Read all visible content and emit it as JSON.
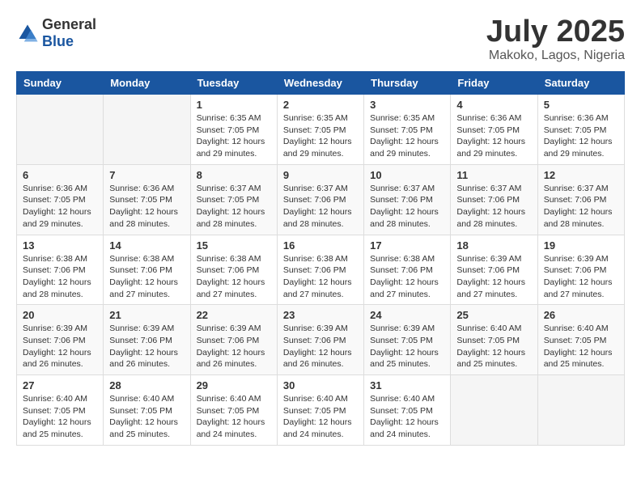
{
  "logo": {
    "general": "General",
    "blue": "Blue"
  },
  "header": {
    "month": "July 2025",
    "location": "Makoko, Lagos, Nigeria"
  },
  "weekdays": [
    "Sunday",
    "Monday",
    "Tuesday",
    "Wednesday",
    "Thursday",
    "Friday",
    "Saturday"
  ],
  "weeks": [
    [
      {
        "day": "",
        "info": ""
      },
      {
        "day": "",
        "info": ""
      },
      {
        "day": "1",
        "info": "Sunrise: 6:35 AM\nSunset: 7:05 PM\nDaylight: 12 hours\nand 29 minutes."
      },
      {
        "day": "2",
        "info": "Sunrise: 6:35 AM\nSunset: 7:05 PM\nDaylight: 12 hours\nand 29 minutes."
      },
      {
        "day": "3",
        "info": "Sunrise: 6:35 AM\nSunset: 7:05 PM\nDaylight: 12 hours\nand 29 minutes."
      },
      {
        "day": "4",
        "info": "Sunrise: 6:36 AM\nSunset: 7:05 PM\nDaylight: 12 hours\nand 29 minutes."
      },
      {
        "day": "5",
        "info": "Sunrise: 6:36 AM\nSunset: 7:05 PM\nDaylight: 12 hours\nand 29 minutes."
      }
    ],
    [
      {
        "day": "6",
        "info": "Sunrise: 6:36 AM\nSunset: 7:05 PM\nDaylight: 12 hours\nand 29 minutes."
      },
      {
        "day": "7",
        "info": "Sunrise: 6:36 AM\nSunset: 7:05 PM\nDaylight: 12 hours\nand 28 minutes."
      },
      {
        "day": "8",
        "info": "Sunrise: 6:37 AM\nSunset: 7:05 PM\nDaylight: 12 hours\nand 28 minutes."
      },
      {
        "day": "9",
        "info": "Sunrise: 6:37 AM\nSunset: 7:06 PM\nDaylight: 12 hours\nand 28 minutes."
      },
      {
        "day": "10",
        "info": "Sunrise: 6:37 AM\nSunset: 7:06 PM\nDaylight: 12 hours\nand 28 minutes."
      },
      {
        "day": "11",
        "info": "Sunrise: 6:37 AM\nSunset: 7:06 PM\nDaylight: 12 hours\nand 28 minutes."
      },
      {
        "day": "12",
        "info": "Sunrise: 6:37 AM\nSunset: 7:06 PM\nDaylight: 12 hours\nand 28 minutes."
      }
    ],
    [
      {
        "day": "13",
        "info": "Sunrise: 6:38 AM\nSunset: 7:06 PM\nDaylight: 12 hours\nand 28 minutes."
      },
      {
        "day": "14",
        "info": "Sunrise: 6:38 AM\nSunset: 7:06 PM\nDaylight: 12 hours\nand 27 minutes."
      },
      {
        "day": "15",
        "info": "Sunrise: 6:38 AM\nSunset: 7:06 PM\nDaylight: 12 hours\nand 27 minutes."
      },
      {
        "day": "16",
        "info": "Sunrise: 6:38 AM\nSunset: 7:06 PM\nDaylight: 12 hours\nand 27 minutes."
      },
      {
        "day": "17",
        "info": "Sunrise: 6:38 AM\nSunset: 7:06 PM\nDaylight: 12 hours\nand 27 minutes."
      },
      {
        "day": "18",
        "info": "Sunrise: 6:39 AM\nSunset: 7:06 PM\nDaylight: 12 hours\nand 27 minutes."
      },
      {
        "day": "19",
        "info": "Sunrise: 6:39 AM\nSunset: 7:06 PM\nDaylight: 12 hours\nand 27 minutes."
      }
    ],
    [
      {
        "day": "20",
        "info": "Sunrise: 6:39 AM\nSunset: 7:06 PM\nDaylight: 12 hours\nand 26 minutes."
      },
      {
        "day": "21",
        "info": "Sunrise: 6:39 AM\nSunset: 7:06 PM\nDaylight: 12 hours\nand 26 minutes."
      },
      {
        "day": "22",
        "info": "Sunrise: 6:39 AM\nSunset: 7:06 PM\nDaylight: 12 hours\nand 26 minutes."
      },
      {
        "day": "23",
        "info": "Sunrise: 6:39 AM\nSunset: 7:06 PM\nDaylight: 12 hours\nand 26 minutes."
      },
      {
        "day": "24",
        "info": "Sunrise: 6:39 AM\nSunset: 7:05 PM\nDaylight: 12 hours\nand 25 minutes."
      },
      {
        "day": "25",
        "info": "Sunrise: 6:40 AM\nSunset: 7:05 PM\nDaylight: 12 hours\nand 25 minutes."
      },
      {
        "day": "26",
        "info": "Sunrise: 6:40 AM\nSunset: 7:05 PM\nDaylight: 12 hours\nand 25 minutes."
      }
    ],
    [
      {
        "day": "27",
        "info": "Sunrise: 6:40 AM\nSunset: 7:05 PM\nDaylight: 12 hours\nand 25 minutes."
      },
      {
        "day": "28",
        "info": "Sunrise: 6:40 AM\nSunset: 7:05 PM\nDaylight: 12 hours\nand 25 minutes."
      },
      {
        "day": "29",
        "info": "Sunrise: 6:40 AM\nSunset: 7:05 PM\nDaylight: 12 hours\nand 24 minutes."
      },
      {
        "day": "30",
        "info": "Sunrise: 6:40 AM\nSunset: 7:05 PM\nDaylight: 12 hours\nand 24 minutes."
      },
      {
        "day": "31",
        "info": "Sunrise: 6:40 AM\nSunset: 7:05 PM\nDaylight: 12 hours\nand 24 minutes."
      },
      {
        "day": "",
        "info": ""
      },
      {
        "day": "",
        "info": ""
      }
    ]
  ]
}
